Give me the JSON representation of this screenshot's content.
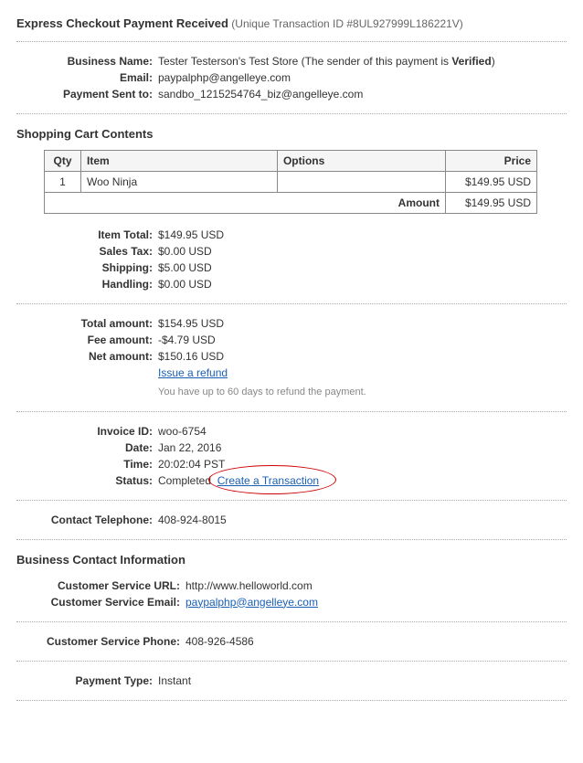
{
  "header": {
    "title": "Express Checkout Payment Received",
    "sub": "(Unique Transaction ID #8UL927999L186221V)"
  },
  "business": {
    "name_label": "Business Name:",
    "name_value": "Tester Testerson's Test Store (The sender of this payment is ",
    "name_verified": "Verified",
    "name_tail": ")",
    "email_label": "Email:",
    "email_value": "paypalphp@angelleye.com",
    "sent_label": "Payment Sent to:",
    "sent_value": "sandbo_1215254764_biz@angelleye.com"
  },
  "cart": {
    "title": "Shopping Cart Contents",
    "headers": {
      "qty": "Qty",
      "item": "Item",
      "options": "Options",
      "price": "Price"
    },
    "rows": [
      {
        "qty": "1",
        "item": "Woo Ninja",
        "options": "",
        "price": "$149.95 USD"
      }
    ],
    "amount_label": "Amount",
    "amount_value": "$149.95 USD"
  },
  "totals": {
    "item_total_label": "Item Total:",
    "item_total_value": "$149.95 USD",
    "sales_tax_label": "Sales Tax:",
    "sales_tax_value": "$0.00 USD",
    "shipping_label": "Shipping:",
    "shipping_value": "$5.00 USD",
    "handling_label": "Handling:",
    "handling_value": "$0.00 USD"
  },
  "amounts": {
    "total_label": "Total amount:",
    "total_value": "$154.95 USD",
    "fee_label": "Fee amount:",
    "fee_value": "-$4.79 USD",
    "net_label": "Net amount:",
    "net_value": "$150.16 USD",
    "refund_link": "Issue a refund",
    "refund_note": "You have up to 60 days to refund the payment."
  },
  "meta": {
    "invoice_label": "Invoice ID:",
    "invoice_value": "woo-6754",
    "date_label": "Date:",
    "date_value": "Jan 22, 2016",
    "time_label": "Time:",
    "time_value": "20:02:04 PST",
    "status_label": "Status:",
    "status_value": "Completed",
    "create_link": "Create a Transaction"
  },
  "contact": {
    "tel_label": "Contact Telephone:",
    "tel_value": "408-924-8015"
  },
  "bizcontact": {
    "title": "Business Contact Information",
    "url_label": "Customer Service URL:",
    "url_value": "http://www.helloworld.com",
    "email_label": "Customer Service Email:",
    "email_value": "paypalphp@angelleye.com",
    "phone_label": "Customer Service Phone:",
    "phone_value": "408-926-4586"
  },
  "payment": {
    "type_label": "Payment Type:",
    "type_value": "Instant"
  }
}
